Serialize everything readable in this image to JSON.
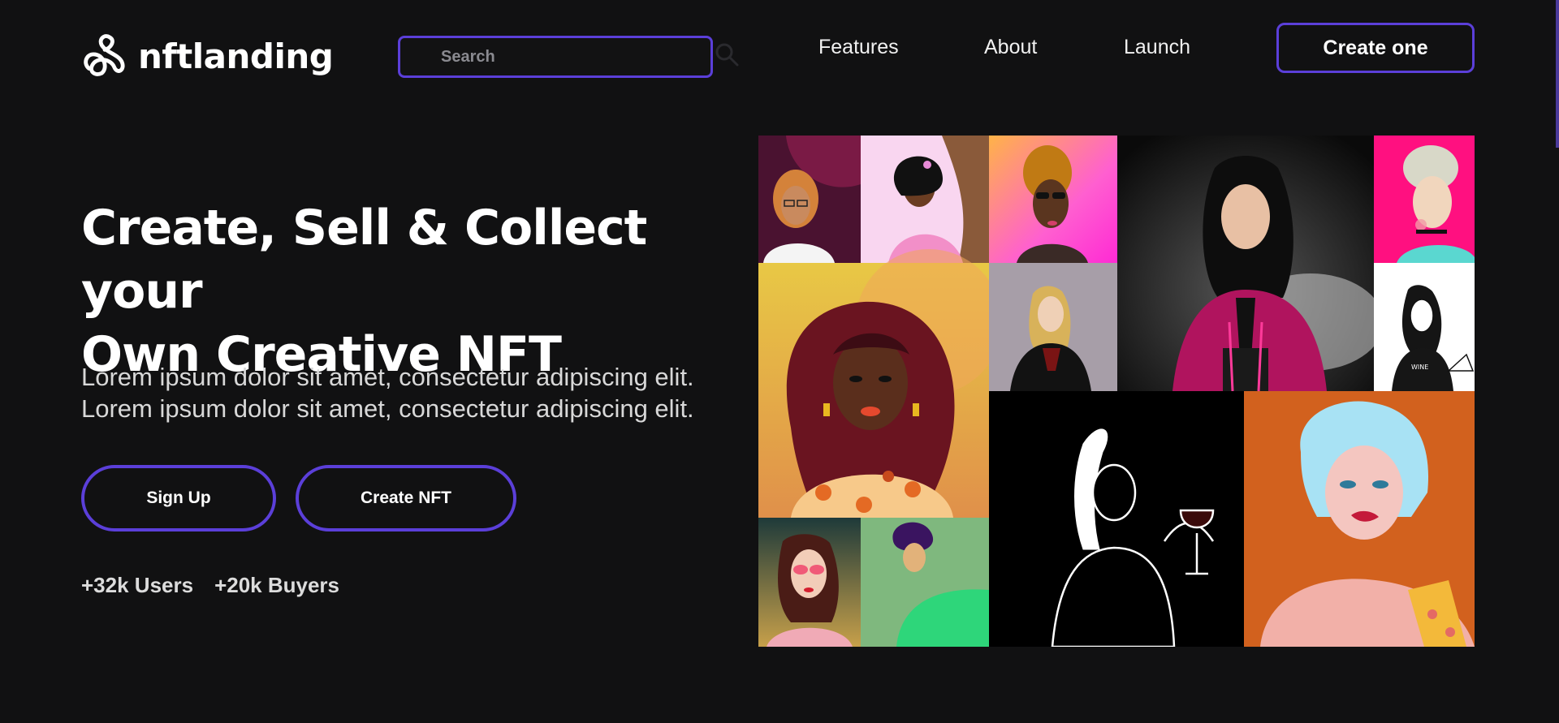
{
  "header": {
    "logo_text": "nftlanding",
    "search": {
      "placeholder": "Search",
      "value": ""
    },
    "nav": [
      {
        "label": "Features"
      },
      {
        "label": "About"
      },
      {
        "label": "Launch"
      }
    ],
    "cta_label": "Create one"
  },
  "hero": {
    "title_line1": "Create, Sell & Collect your",
    "title_line2": "Own Creative NFT",
    "description": [
      "Lorem ipsum dolor sit amet, consectetur adipiscing elit.",
      "Lorem ipsum dolor sit amet, consectetur adipiscing elit."
    ],
    "buttons": {
      "signup": "Sign Up",
      "create_nft": "Create NFT"
    },
    "stats": [
      {
        "text": "+32k Users"
      },
      {
        "text": "+20k Buyers"
      }
    ]
  },
  "gallery": {
    "tiles": [
      "portrait-orange-hair-glasses",
      "portrait-pink-bow-girl",
      "portrait-gold-hair-sunglasses",
      "portrait-black-hair-magenta-outfit",
      "portrait-silver-hair-pink",
      "portrait-curly-hair-floral-shirt",
      "portrait-blonde-black-dress",
      "portrait-line-art-wine-slayer-shirt",
      "portrait-red-glasses",
      "portrait-purple-hair-green",
      "portrait-line-art-wine-glass",
      "portrait-blue-bob-hair"
    ]
  },
  "colors": {
    "background": "#111112",
    "accent": "#5b3fd9",
    "text": "#ffffff",
    "muted_text": "#d8d8d8"
  }
}
